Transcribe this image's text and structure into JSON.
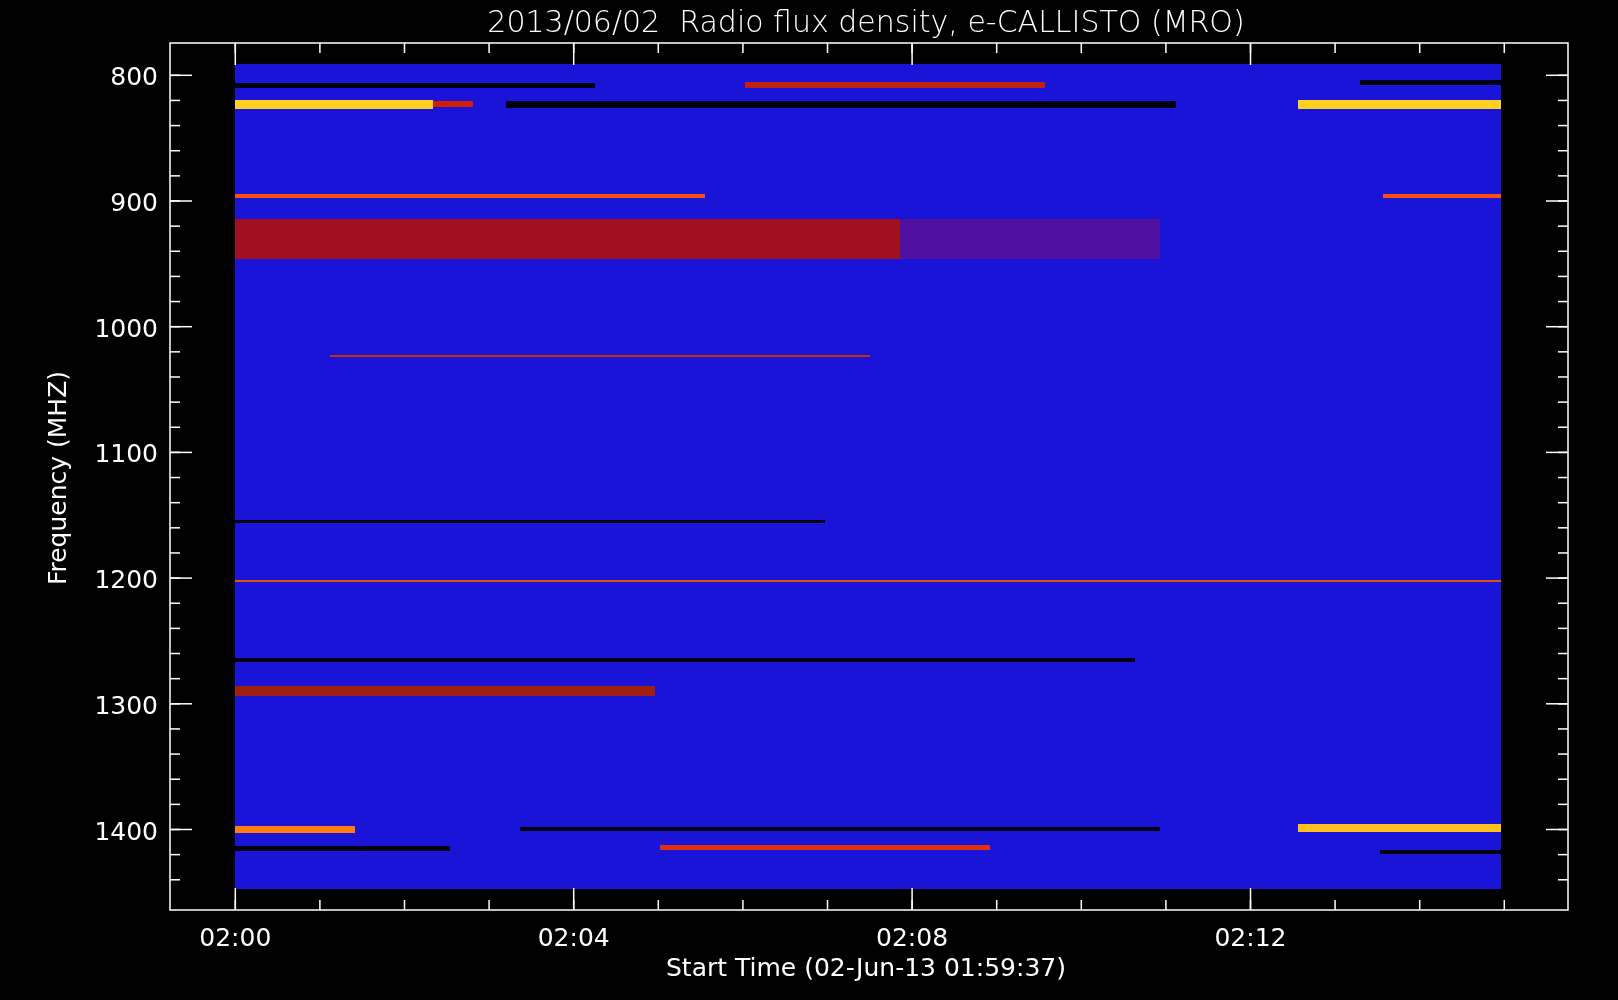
{
  "title": "2013/06/02  Radio flux density, e-CALLISTO (MRO)",
  "y_axis": {
    "label": "Frequency (MHZ)",
    "ticks": [
      "800",
      "900",
      "1000",
      "1100",
      "1200",
      "1300",
      "1400"
    ]
  },
  "x_axis": {
    "label": "Start Time (02-Jun-13 01:59:37)",
    "ticks": [
      "02:00",
      "02:04",
      "02:08",
      "02:12"
    ]
  }
}
